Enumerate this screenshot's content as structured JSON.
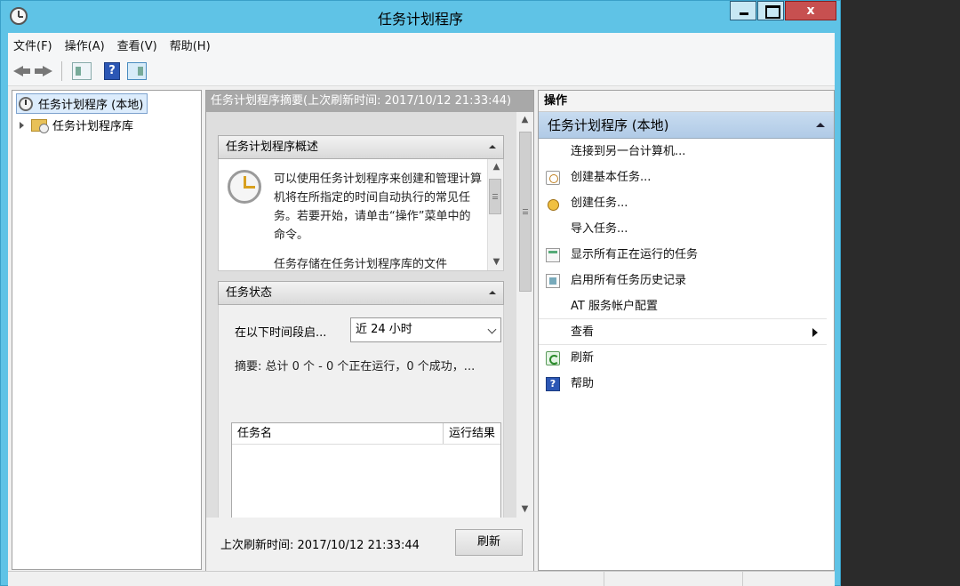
{
  "window": {
    "title": "任务计划程序",
    "close_label": "x"
  },
  "menu": [
    "文件(F)",
    "操作(A)",
    "查看(V)",
    "帮助(H)"
  ],
  "toolbar": {
    "help_label": "?"
  },
  "tree": {
    "root_label": "任务计划程序 (本地)",
    "child_label": "任务计划程序库"
  },
  "center": {
    "header": "任务计划程序摘要(上次刷新时间: 2017/10/12 21:33:44)",
    "overview": {
      "title": "任务计划程序概述",
      "text1": "可以使用任务计划程序来创建和管理计算机将在所指定的时间自动执行的常见任务。若要开始，请单击“操作”菜单中的命令。",
      "text2": "任务存储在任务计划程序库的文件"
    },
    "status": {
      "title": "任务状态",
      "label": "在以下时间段启...",
      "range_value": "近 24 小时",
      "summary": "摘要: 总计 0 个 - 0 个正在运行，0 个成功，...",
      "columns": [
        "任务名",
        "运行结果"
      ]
    },
    "footer_text": "上次刷新时间: 2017/10/12 21:33:44",
    "refresh_button": "刷新"
  },
  "actions": {
    "title": "操作",
    "group": "任务计划程序 (本地)",
    "items": [
      {
        "label": "连接到另一台计算机...",
        "icon": "connect-icon"
      },
      {
        "label": "创建基本任务...",
        "icon": "basic-task-icon"
      },
      {
        "label": "创建任务...",
        "icon": "create-task-icon"
      },
      {
        "label": "导入任务...",
        "icon": "import-icon"
      },
      {
        "label": "显示所有正在运行的任务",
        "icon": "running-tasks-icon"
      },
      {
        "label": "启用所有任务历史记录",
        "icon": "history-icon"
      },
      {
        "label": "AT 服务帐户配置",
        "icon": "at-config-icon"
      },
      {
        "label": "查看",
        "icon": "view-icon"
      },
      {
        "label": "刷新",
        "icon": "refresh-icon"
      },
      {
        "label": "帮助",
        "icon": "help-icon"
      }
    ],
    "help_glyph": "?"
  }
}
